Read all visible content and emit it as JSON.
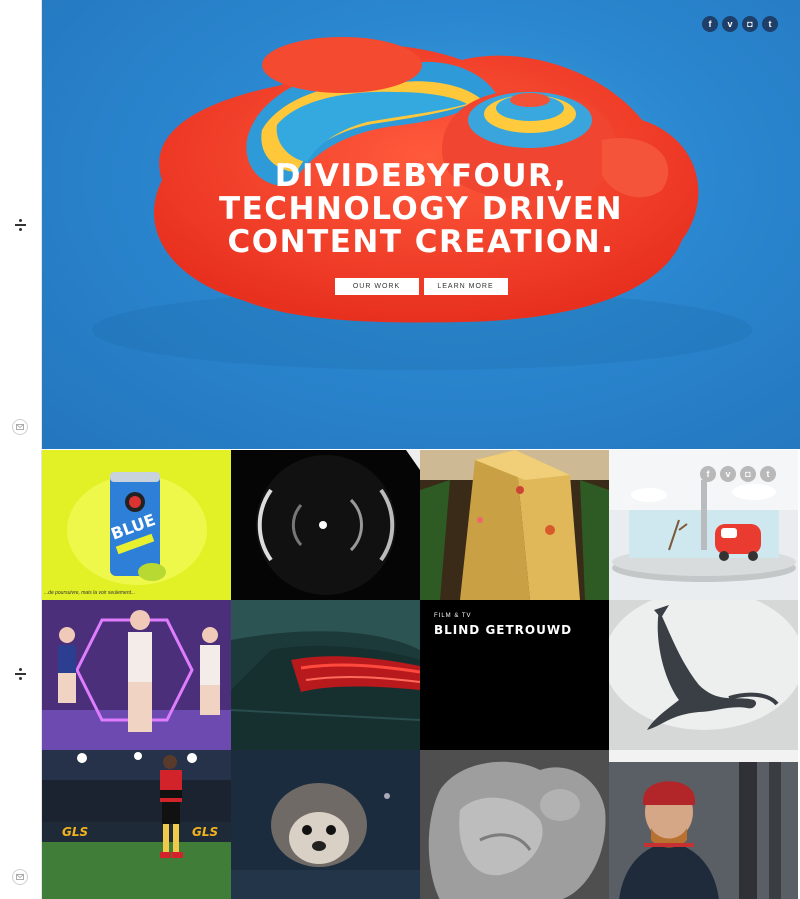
{
  "colors": {
    "hero_background": "#2a86cf",
    "blob_red": "#f03a2a",
    "social_dark": "#1d3f6a",
    "social_light": "#b9b9b9"
  },
  "rail": {
    "logo_icon": "divide-icon",
    "contact_icon": "mail-icon"
  },
  "hero": {
    "headline_lines": [
      "DIVIDEBYFOUR,",
      "TECHNOLOGY DRIVEN",
      "CONTENT CREATION."
    ],
    "buttons": [
      "OUR WORK",
      "LEARN MORE"
    ],
    "social": [
      "f",
      "v",
      "◘",
      "t"
    ]
  },
  "grid": {
    "social": [
      "f",
      "v",
      "◘",
      "t"
    ],
    "tiles": [
      {
        "id": "blue-can",
        "note": "...de poursuivre, mais la voir seulement..."
      },
      {
        "id": "dark-eye"
      },
      {
        "id": "gift-wrap"
      },
      {
        "id": "toy-car"
      },
      {
        "id": "neon-dancers"
      },
      {
        "id": "car-taillight"
      },
      {
        "id": "blind-getrouwd",
        "category": "FILM & TV",
        "title": "BLIND GETROUWD"
      },
      {
        "id": "whale"
      },
      {
        "id": "football-player",
        "ad_text": "GLS"
      },
      {
        "id": "hedgehog"
      },
      {
        "id": "sculpture"
      },
      {
        "id": "man-red-beanie"
      }
    ]
  }
}
